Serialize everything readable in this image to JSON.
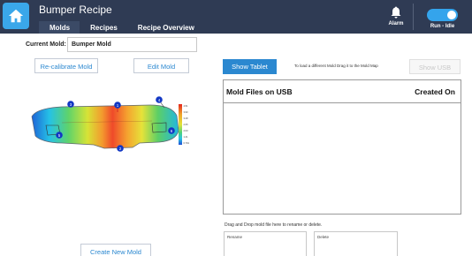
{
  "header": {
    "title": "Bumper Recipe",
    "tabs": [
      {
        "label": "Molds",
        "active": true
      },
      {
        "label": "Recipes",
        "active": false
      },
      {
        "label": "Recipe Overview",
        "active": false
      }
    ],
    "alarm_label": "Alarm",
    "run_status_label": "Run - Idle",
    "run_toggle_on": true,
    "colors": {
      "bar": "#2f3b54",
      "accent": "#34a4ec"
    }
  },
  "mold": {
    "current_label": "Current Mold:",
    "current_value": "Bumper Mold",
    "recalibrate_label": "Re-calibrate Mold",
    "edit_label": "Edit Mold",
    "create_label": "Create New Mold",
    "markers": [
      "1",
      "2",
      "3",
      "4",
      "5",
      "6"
    ],
    "scale_labels": [
      "4.51",
      "3.90",
      "3.28",
      "2.65",
      "2.03",
      "1.41",
      "0.791"
    ]
  },
  "usb": {
    "show_tablet_label": "Show Tablet",
    "drag_hint": "To load a different Mold Drag it to the Mold Map",
    "show_usb_label": "Show USB",
    "table_headers": {
      "file": "Mold Files on USB",
      "created": "Created On"
    },
    "rows": [],
    "drop_hint": "Drag and Drop mold file here to rename or delete.",
    "rename_label": "Rename",
    "delete_label": "Delete"
  }
}
